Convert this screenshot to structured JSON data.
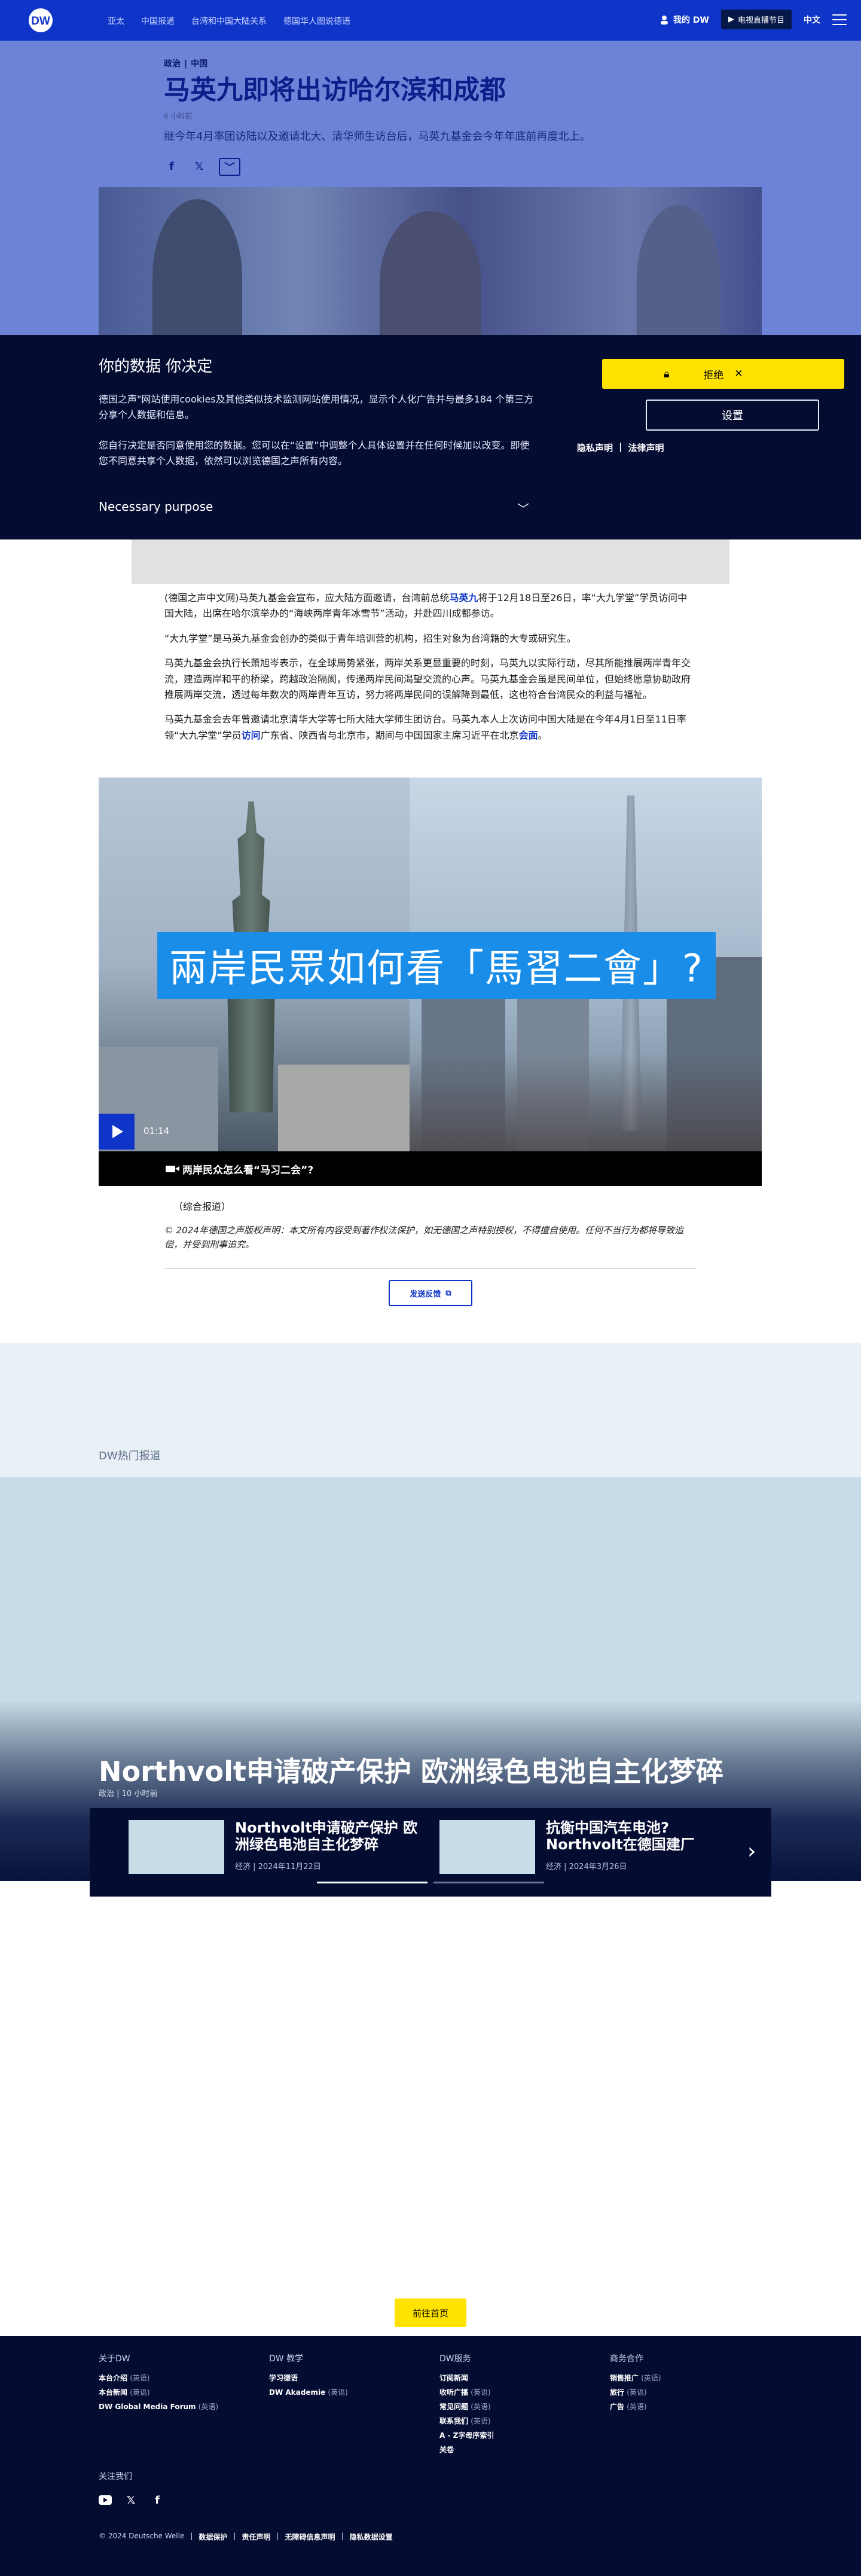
{
  "header": {
    "nav": [
      "亚太",
      "中国报道",
      "台湾和中国大陆关系",
      "德国华人图说德语"
    ],
    "login": "我的 DW",
    "live": "电视直播节目",
    "lang": "中文"
  },
  "article": {
    "kicker_a": "政治",
    "kicker_b": "中国",
    "title": "马英九即将出访哈尔滨和成都",
    "time": "6 小时前",
    "teaser": "继今年4月率团访陆以及邀请北大、清华师生访台后，马英九基金会今年年底前再度北上。",
    "p1_pre": "(德国之声中文网)马英九基金会宣布，应大陆方面邀请，台湾前总统",
    "p1_link": "马英九",
    "p1_post": "将于12月18日至26日，率“大九学堂”学员访问中国大陆，出席在哈尔滨举办的“海峡两岸青年冰雪节”活动，并赴四川成都参访。",
    "p2": "“大九学堂”是马英九基金会创办的类似于青年培训营的机构，招生对象为台湾籍的大专或研究生。",
    "p3": "马英九基金会执行长萧旭岑表示，在全球局势紧张，两岸关系更显重要的时刻，马英九以实际行动，尽其所能推展两岸青年交流，建造两岸和平的桥梁，跨越政治隔阂，传递两岸民间渴望交流的心声。马英九基金会虽是民间单位，但始终愿意协助政府推展两岸交流，透过每年数次的两岸青年互访，努力将两岸民间的误解降到最低，这也符合台湾民众的利益与福祉。",
    "p4_pre": "马英九基金会去年曾邀请北京清华大学等七所大陆大学师生团访台。马英九本人上次访问中国大陆是在今年4月1日至11日率领“大九学堂”学员",
    "p4_link1": "访问",
    "p4_mid": "广东省、陕西省与北京市，期间与中国国家主席习近平在北京",
    "p4_link2": "会面",
    "p4_end": "。",
    "video_caption": "兩岸民眾如何看「馬習二會」?",
    "video_time": "01:14",
    "video_title": "两岸民众怎么看“马习二会”?",
    "source": "（综合报道）",
    "copyright": "© 2024年德国之声版权声明：本文所有内容受到著作权法保护，如无德国之声特别授权，不得擅自使用。任何不当行为都将导致追偿，并受到刑事追究。",
    "feedback": "发送反馈"
  },
  "consent": {
    "title": "你的数据 你决定",
    "p1": "德国之声\"网站使用cookies及其他类似技术监测网站使用情况，显示个人化广告并与最多184 个第三方分享个人数据和信息。",
    "p2": "您自行决定是否同意使用您的数据。您可以在“设置”中调整个人具体设置并在任何时候加以改变。即使您不同意共享个人数据，依然可以浏览德国之声所有内容。",
    "purpose": "Necessary purpose",
    "reject": "拒绝",
    "settings": "设置",
    "privacy": "隐私声明",
    "legal": "法律声明"
  },
  "most_read": {
    "label": "DW热门报道",
    "headline": "Northvolt申请破产保护 欧洲绿色电池自主化梦碎",
    "meta": "政治 | 10 小时前",
    "slides": [
      {
        "title": "Northvolt申请破产保护 欧洲绿色电池自主化梦碎",
        "meta": "经济 | 2024年11月22日"
      },
      {
        "title": "抗衡中国汽车电池? Northvolt在德国建厂",
        "meta": "经济 | 2024年3月26日"
      }
    ],
    "home": "前往首页"
  },
  "footer": {
    "col1_title": "关于DW",
    "col1": [
      {
        "t": "本台介绍",
        "n": "(英语)"
      },
      {
        "t": "本台新闻",
        "n": "(英语)"
      },
      {
        "t": "DW Global Media Forum",
        "n": "(英语)"
      }
    ],
    "col2_title": "DW 教学",
    "col2": [
      {
        "t": "学习德语",
        "n": ""
      },
      {
        "t": "DW Akademie",
        "n": "(英语)"
      }
    ],
    "col3_title": "DW服务",
    "col3": [
      {
        "t": "订阅新闻",
        "n": ""
      },
      {
        "t": "收听广播",
        "n": "(英语)"
      },
      {
        "t": "常见问题",
        "n": "(英语)"
      },
      {
        "t": "联系我们",
        "n": "(英语)"
      },
      {
        "t": "A - Z字母序索引",
        "n": ""
      },
      {
        "t": "关卷",
        "n": ""
      }
    ],
    "col4_title": "商务合作",
    "col4": [
      {
        "t": "销售推广",
        "n": "(英语)"
      },
      {
        "t": "旅行",
        "n": "(英语)"
      },
      {
        "t": "广告",
        "n": "(英语)"
      }
    ],
    "follow": "关注我们",
    "bottom_copy": "© 2024 Deutsche Welle",
    "bottom_links": [
      "数据保护",
      "责任声明",
      "无障碍信息声明",
      "隐私数据设置"
    ]
  }
}
